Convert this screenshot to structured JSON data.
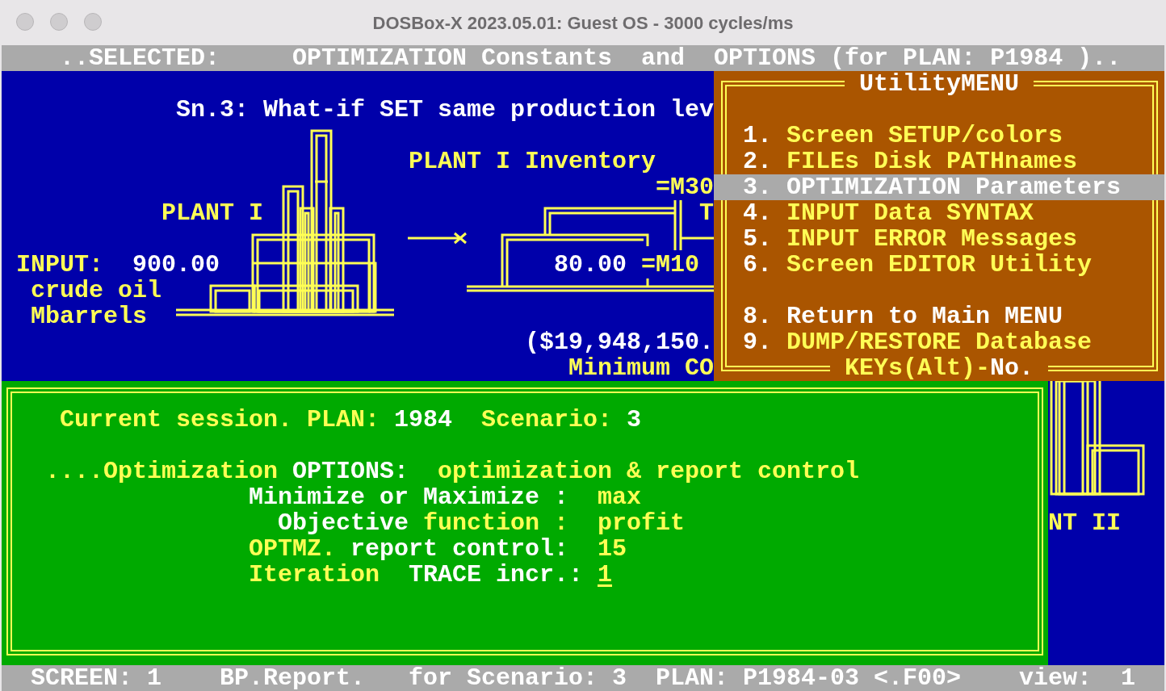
{
  "window": {
    "title": "DOSBox-X 2023.05.01: Guest OS - 3000 cycles/ms"
  },
  "header_bar": {
    "label": "..SELECTED:",
    "text": "OPTIMIZATION Constants  and  OPTIONS (for PLAN: P1984 ).."
  },
  "diagram": {
    "heading": "Sn.3: What-if SET same production lev",
    "inventory_label": "PLANT I Inventory",
    "inventory_marker": "=M30",
    "cut_letter": "T",
    "plant_label": "PLANT I",
    "input_label": "INPUT:",
    "input_value": "900.00",
    "input_unit": "crude oil",
    "input_measure": "Mbarrels",
    "inventory_value": "80.00",
    "inventory_min_marker": "=M10",
    "cost": "($19,948,150.",
    "cost_label": "Minimum CO",
    "plant2_label": "NT II"
  },
  "utility_menu": {
    "title": "UtilityMENU",
    "groups": [
      [
        {
          "number": "1.",
          "label": "Screen SETUP/colors",
          "selected": false,
          "color": "#ffff55"
        },
        {
          "number": "2.",
          "label": "FILEs Disk PATHnames",
          "selected": false,
          "color": "#ffff55"
        },
        {
          "number": "3.",
          "label": "OPTIMIZATION Parameters",
          "selected": true
        },
        {
          "number": "4.",
          "label": "INPUT Data SYNTAX",
          "selected": false,
          "color": "#ffff55"
        },
        {
          "number": "5.",
          "label": "INPUT ERROR Messages",
          "selected": false,
          "color": "#ffff55"
        },
        {
          "number": "6.",
          "label": "Screen EDITOR Utility",
          "selected": false,
          "color": "#ffff55"
        }
      ],
      [
        {
          "number": "8.",
          "label": "Return to Main MENU",
          "selected": false,
          "color": "#ffffff"
        },
        {
          "number": "9.",
          "label": "DUMP/RESTORE Database",
          "selected": false,
          "color": "#ffff55"
        }
      ]
    ],
    "footer_keys": "KEYs(Alt)-",
    "footer_no": "No."
  },
  "session_panel": {
    "lines": [
      [
        {
          "text": "Current session. PLAN:",
          "color": "#ffff55",
          "kind": "text"
        },
        {
          "text": "1984",
          "color": "#ffffff",
          "kind": "text"
        },
        {
          "text": "Scenario:",
          "color": "#ffff55",
          "kind": "text"
        },
        {
          "text": "3",
          "color": "#ffffff",
          "kind": "text"
        }
      ],
      [
        {
          "text": "....Optimization",
          "color": "#ffff55",
          "kind": "text"
        },
        {
          "text": "OPTIONS:",
          "color": "#ffffff",
          "kind": "text"
        },
        {
          "text": "optimization & report control",
          "color": "#ffff55",
          "kind": "text"
        }
      ],
      [
        {
          "text": "Minimize or Maximize :",
          "color": "#ffffff",
          "kind": "text"
        },
        {
          "text": "max",
          "color": "#ffff55",
          "kind": "text"
        }
      ],
      [
        {
          "text": "Objective",
          "color": "#ffffff",
          "kind": "text"
        },
        {
          "text": "function :",
          "color": "#ffff55",
          "kind": "text"
        },
        {
          "text": "profit",
          "color": "#ffff55",
          "kind": "text"
        }
      ],
      [
        {
          "text": "OPTMZ.",
          "color": "#ffff55",
          "kind": "text"
        },
        {
          "text": "report control:",
          "color": "#ffffff",
          "kind": "text"
        },
        {
          "text": "15",
          "color": "#ffff55",
          "kind": "text"
        }
      ],
      [
        {
          "text": "Iteration",
          "color": "#ffff55",
          "kind": "text"
        },
        {
          "text": "TRACE incr.:",
          "color": "#ffffff",
          "kind": "text"
        },
        {
          "text": "1",
          "color": "#ffff55",
          "kind": "input"
        }
      ]
    ]
  },
  "status_bar": [
    "SCREEN: 1",
    "BP.Report.",
    "for Scenario: 3",
    "PLAN: P1984-03 <.F00>",
    "view:",
    "1"
  ]
}
